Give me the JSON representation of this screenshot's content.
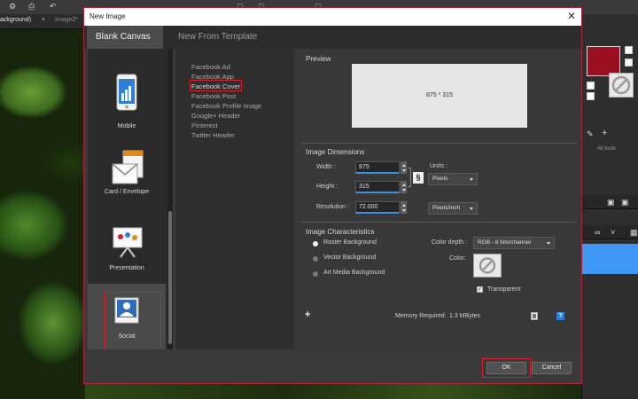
{
  "app": {
    "tabs": [
      {
        "label": "ackground)"
      },
      {
        "label": "Image2*"
      }
    ],
    "tab_close": "×",
    "right_panel": {
      "all_tools_label": "All tools",
      "foreground_color": "#9a1020"
    }
  },
  "dialog": {
    "title": "New Image",
    "close_glyph": "✕",
    "tabs": [
      {
        "label": "Blank Canvas",
        "active": true
      },
      {
        "label": "New From Template",
        "active": false
      }
    ],
    "categories": [
      {
        "label": "Mobile",
        "icon": "mobile-icon"
      },
      {
        "label": "Card / Envelope",
        "icon": "envelope-icon"
      },
      {
        "label": "Presentation",
        "icon": "presentation-icon"
      },
      {
        "label": "Social",
        "icon": "social-icon",
        "selected": true
      }
    ],
    "templates": [
      "Facebook Ad",
      "Facebook App",
      "Facebook Cover",
      "Facebook Post",
      "Facebook Profile Image",
      "Google+ Header",
      "Pinterest",
      "Twitter Header"
    ],
    "selected_template": "Facebook Cover",
    "preview": {
      "title": "Preview",
      "text": "875 * 315"
    },
    "dimensions": {
      "title": "Image Dimensions",
      "width_label": "Width :",
      "width_value": "875",
      "height_label": "Height :",
      "height_value": "315",
      "resolution_label": "Resolution :",
      "resolution_value": "72.000",
      "units_label": "Units :",
      "units_value": "Pixels",
      "resolution_unit_value": "Pixels/inch",
      "link_glyph": "§"
    },
    "characteristics": {
      "title": "Image Characteristics",
      "options": [
        {
          "label": "Raster Background",
          "checked": true
        },
        {
          "label": "Vector Background",
          "checked": false
        },
        {
          "label": "Art Media Background",
          "checked": false
        }
      ],
      "color_depth_label": "Color depth :",
      "color_depth_value": "RGB - 8 bits/channel",
      "color_label": "Color:",
      "transparent_label": "Transparent",
      "transparent_checked": "✓"
    },
    "memory_label": "Memory Required:",
    "memory_value": "1.3 MBytes",
    "plus_glyph": "+",
    "help_glyph": "?",
    "ok_label": "OK",
    "cancel_label": "Cancel"
  }
}
